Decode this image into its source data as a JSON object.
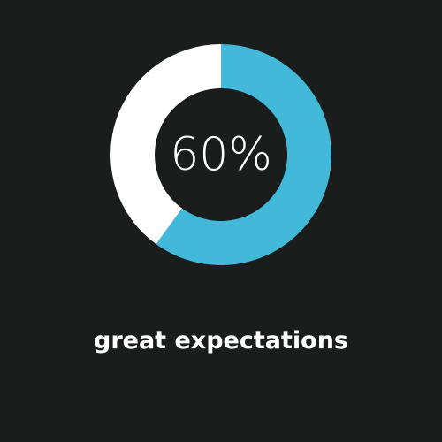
{
  "chart_data": {
    "type": "pie",
    "variant": "donut",
    "value_percent": 60,
    "slices": [
      {
        "value": 60,
        "color": "#42b9d9"
      },
      {
        "value": 40,
        "color": "#ffffff"
      }
    ],
    "center_label": "60%",
    "caption": "great expectations"
  },
  "colors": {
    "background": "#1b1d1d",
    "filled": "#42b9d9",
    "remaining": "#ffffff",
    "text": "#ffffff"
  }
}
